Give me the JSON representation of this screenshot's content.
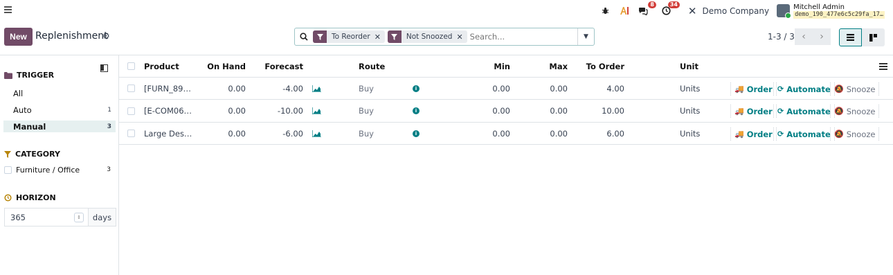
{
  "navbar": {
    "message_badge": "8",
    "activity_badge": "34",
    "company": "Demo Company",
    "user_name": "Mitchell Admin",
    "user_db": "demo_190_477e6c5c29fa_17…"
  },
  "control": {
    "new_label": "New",
    "title": "Replenishment",
    "facets": [
      "To Reorder",
      "Not Snoozed"
    ],
    "search_placeholder": "Search...",
    "pager": "1-3 / 3"
  },
  "sidebar": {
    "trigger_title": "TRIGGER",
    "trigger_items": [
      {
        "label": "All",
        "count": ""
      },
      {
        "label": "Auto",
        "count": "1"
      },
      {
        "label": "Manual",
        "count": "3"
      }
    ],
    "category_title": "CATEGORY",
    "category_items": [
      {
        "label": "Furniture / Office",
        "count": "3"
      }
    ],
    "horizon_title": "HORIZON",
    "horizon_value": "365",
    "horizon_unit": "days"
  },
  "table": {
    "headers": {
      "product": "Product",
      "on_hand": "On Hand",
      "forecast": "Forecast",
      "route": "Route",
      "min": "Min",
      "max": "Max",
      "to_order": "To Order",
      "unit": "Unit"
    },
    "rows": [
      {
        "product": "[FURN_89…",
        "on_hand": "0.00",
        "forecast": "-4.00",
        "route": "Buy",
        "min": "0.00",
        "max": "0.00",
        "to_order": "4.00",
        "unit": "Units"
      },
      {
        "product": "[E-COM06…",
        "on_hand": "0.00",
        "forecast": "-10.00",
        "route": "Buy",
        "min": "0.00",
        "max": "0.00",
        "to_order": "10.00",
        "unit": "Units"
      },
      {
        "product": "Large Des…",
        "on_hand": "0.00",
        "forecast": "-6.00",
        "route": "Buy",
        "min": "0.00",
        "max": "0.00",
        "to_order": "6.00",
        "unit": "Units"
      }
    ],
    "actions": {
      "order": "Order",
      "automate": "Automate",
      "snooze": "Snooze"
    }
  }
}
